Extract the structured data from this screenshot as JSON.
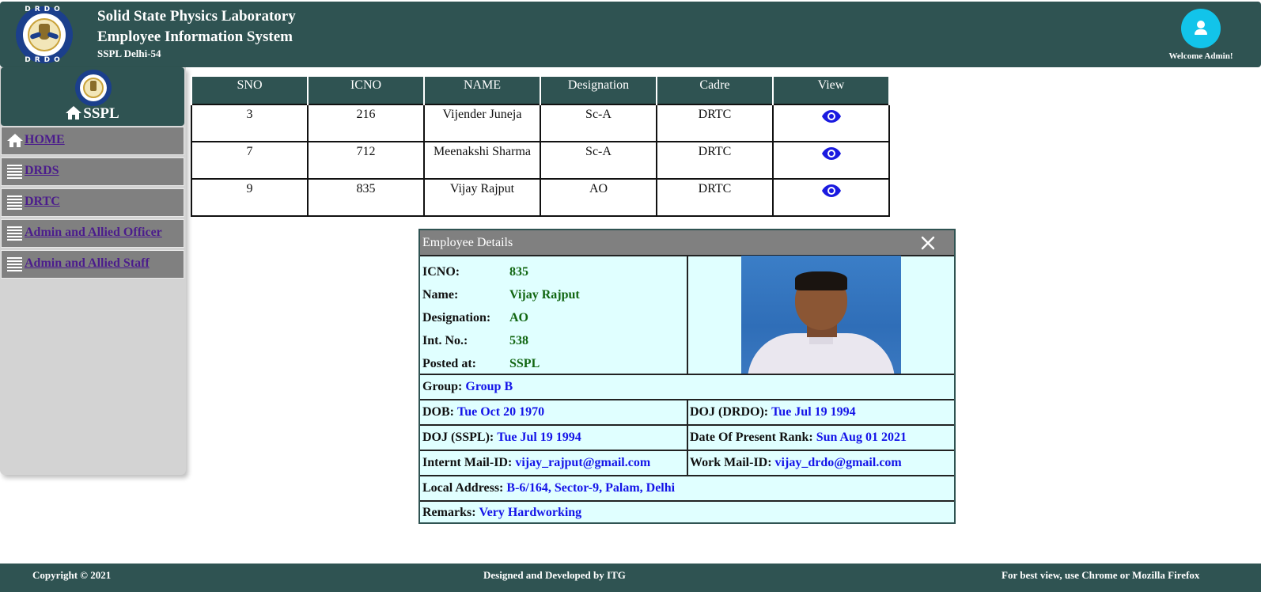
{
  "header": {
    "title_line1": "Solid State Physics Laboratory",
    "title_line2": "Employee Information System",
    "subtitle": "SSPL Delhi-54",
    "logo_top_text": "DRDO",
    "logo_bottom_text": "DRDO",
    "welcome": "Welcome Admin!",
    "logo_icon": "drdo-logo",
    "avatar_icon": "user-icon"
  },
  "sidebar": {
    "title": "SSPL",
    "items": [
      {
        "label": "HOME",
        "icon": "home-icon"
      },
      {
        "label": "DRDS",
        "icon": "list-icon"
      },
      {
        "label": "DRTC",
        "icon": "list-icon"
      },
      {
        "label": "Admin and Allied Officer",
        "icon": "list-icon"
      },
      {
        "label": "Admin and Allied Staff",
        "icon": "list-icon"
      }
    ]
  },
  "table": {
    "headers": [
      "SNO",
      "ICNO",
      "NAME",
      "Designation",
      "Cadre",
      "View"
    ],
    "rows": [
      {
        "sno": "3",
        "icno": "216",
        "name": "Vijender Juneja",
        "designation": "Sc-A",
        "cadre": "DRTC"
      },
      {
        "sno": "7",
        "icno": "712",
        "name": "Meenakshi Sharma",
        "designation": "Sc-A",
        "cadre": "DRTC"
      },
      {
        "sno": "9",
        "icno": "835",
        "name": "Vijay Rajput",
        "designation": "AO",
        "cadre": "DRTC"
      }
    ],
    "view_icon": "eye-icon"
  },
  "modal": {
    "title": "Employee Details",
    "close_icon": "close-icon",
    "icno_label": "ICNO:",
    "icno_value": "835",
    "name_label": "Name:",
    "name_value": "Vijay Rajput",
    "designation_label": "Designation:",
    "designation_value": "AO",
    "intno_label": "Int. No.:",
    "intno_value": "538",
    "posted_label": "Posted at:",
    "posted_value": "SSPL",
    "group_label": "Group:",
    "group_value": "Group B",
    "dob_label": "DOB:",
    "dob_value": "Tue Oct 20 1970",
    "doj_drdo_label": "DOJ (DRDO):",
    "doj_drdo_value": "Tue Jul 19 1994",
    "doj_sspl_label": "DOJ (SSPL):",
    "doj_sspl_value": "Tue Jul 19 1994",
    "present_rank_label": "Date Of Present Rank:",
    "present_rank_value": "Sun Aug 01 2021",
    "internet_mail_label": "Internt Mail-ID:",
    "internet_mail_value": "vijay_rajput@gmail.com",
    "work_mail_label": "Work Mail-ID:",
    "work_mail_value": "vijay_drdo@gmail.com",
    "address_label": "Local Address:",
    "address_value": "B-6/164, Sector-9, Palam, Delhi",
    "remarks_label": "Remarks:",
    "remarks_value": "Very Hardworking"
  },
  "footer": {
    "copyright": "Copyright © 2021",
    "credit": "Designed and Developed by ITG",
    "browser_note": "For best view, use Chrome or Mozilla Firefox"
  },
  "colors": {
    "primary": "#2f5352",
    "nav_bg": "#808080",
    "sidebar_bg": "#d3d3d3",
    "modal_bg": "#e0ffff",
    "link": "#4b1c8c",
    "value_blue": "#1414e8",
    "value_green": "#116611",
    "avatar": "#12c4ea"
  }
}
